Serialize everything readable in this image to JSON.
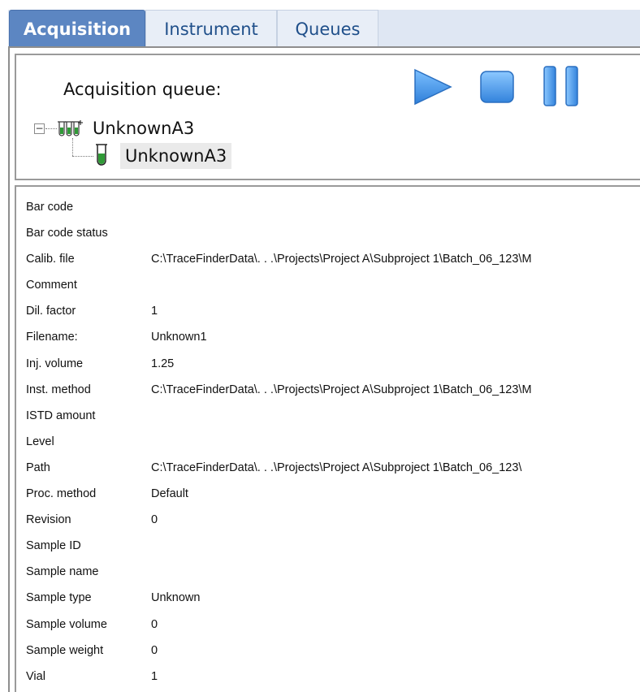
{
  "tabs": [
    {
      "label": "Acquisition",
      "active": true
    },
    {
      "label": "Instrument",
      "active": false
    },
    {
      "label": "Queues",
      "active": false
    }
  ],
  "queue": {
    "title": "Acquisition queue:",
    "controls": [
      {
        "name": "play",
        "icon": "play-icon",
        "color": "#3b8fe8"
      },
      {
        "name": "stop",
        "icon": "stop-icon",
        "color": "#3b8fe8"
      },
      {
        "name": "pause",
        "icon": "pause-icon",
        "color": "#3b8fe8"
      }
    ],
    "tree": {
      "root_label": "UnknownA3",
      "root_icon": "sample-rack-icon",
      "child_label": "UnknownA3",
      "child_icon": "sample-vial-icon"
    }
  },
  "properties": [
    {
      "name": "Bar code",
      "value": ""
    },
    {
      "name": "Bar code status",
      "value": ""
    },
    {
      "name": "Calib. file",
      "value": "C:\\TraceFinderData\\. . .\\Projects\\Project A\\Subproject 1\\Batch_06_123\\M"
    },
    {
      "name": "Comment",
      "value": ""
    },
    {
      "name": "Dil. factor",
      "value": "1"
    },
    {
      "name": "Filename:",
      "value": "Unknown1"
    },
    {
      "name": "Inj. volume",
      "value": "1.25"
    },
    {
      "name": "Inst. method",
      "value": "C:\\TraceFinderData\\. . .\\Projects\\Project A\\Subproject 1\\Batch_06_123\\M"
    },
    {
      "name": "ISTD amount",
      "value": ""
    },
    {
      "name": "Level",
      "value": ""
    },
    {
      "name": "Path",
      "value": "C:\\TraceFinderData\\. . .\\Projects\\Project A\\Subproject 1\\Batch_06_123\\"
    },
    {
      "name": "Proc. method",
      "value": "Default"
    },
    {
      "name": "Revision",
      "value": "0"
    },
    {
      "name": "Sample ID",
      "value": ""
    },
    {
      "name": "Sample name",
      "value": ""
    },
    {
      "name": "Sample type",
      "value": "Unknown"
    },
    {
      "name": "Sample volume",
      "value": "0"
    },
    {
      "name": "Sample weight",
      "value": "0"
    },
    {
      "name": "Vial",
      "value": "1"
    }
  ]
}
